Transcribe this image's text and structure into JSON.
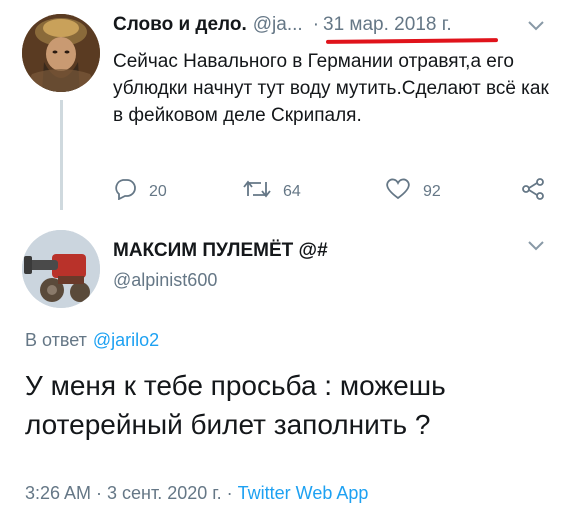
{
  "tweet1": {
    "author_name": "Слово и дело.",
    "author_handle": "@ja...",
    "separator": "·",
    "date": "31 мар. 2018 г.",
    "text": "Сейчас Навального в Германии отравят,а его ублюдки начнут тут воду мутить.Сделают всё как в фейковом деле Скрипаля.",
    "reply_count": "20",
    "retweet_count": "64",
    "like_count": "92",
    "annotation_color": "#e0131b"
  },
  "tweet2": {
    "author_name": "МАКСИМ ПУЛЕМЁТ @#",
    "author_handle": "@alpinist600",
    "reply_prefix": "В ответ",
    "reply_to": "@jarilo2",
    "text": "У меня к тебе просьба : можешь лотерейный билет заполнить ?",
    "meta_time_date": "3:26 AM · 3 сент. 2020 г. · ",
    "meta_source": "Twitter Web App"
  },
  "colors": {
    "text_primary": "#14171a",
    "text_secondary": "#657786",
    "accent": "#1da1f2"
  },
  "icons": [
    "chevron-down-icon",
    "reply-icon",
    "retweet-icon",
    "like-icon",
    "share-icon"
  ]
}
